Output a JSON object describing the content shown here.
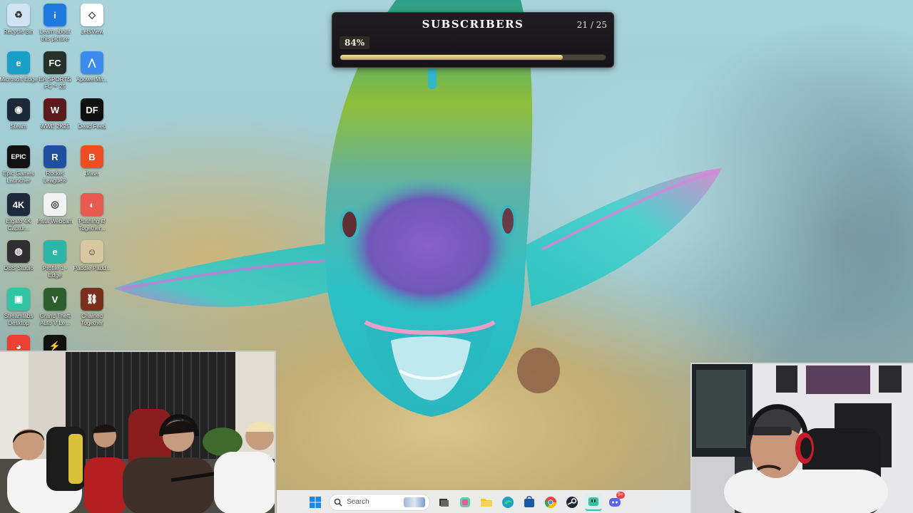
{
  "desktop_icons": [
    {
      "label": "Recycle Bin",
      "icon": "recycle-bin-icon",
      "color": "#cfe3f5",
      "glyph": "♻"
    },
    {
      "label": "Learn about this picture",
      "icon": "info-icon",
      "color": "#1f7ae0",
      "glyph": "i"
    },
    {
      "label": "LetsView",
      "icon": "letsview-icon",
      "color": "#ffffff",
      "glyph": "◇"
    },
    {
      "label": "Microsoft Edge",
      "icon": "edge-icon",
      "color": "#1aa0c8",
      "glyph": "e"
    },
    {
      "label": "EA SPORTS FC™ 25",
      "icon": "ea-sports-fc-icon",
      "color": "#24322a",
      "glyph": "FC"
    },
    {
      "label": "ApowerMir...",
      "icon": "apowermirror-icon",
      "color": "#3c8cf0",
      "glyph": "⋀"
    },
    {
      "label": "Steam",
      "icon": "steam-icon",
      "color": "#1b2838",
      "glyph": "◉"
    },
    {
      "label": "WWE 2K25",
      "icon": "wwe-2k25-icon",
      "color": "#5b1b1b",
      "glyph": "W"
    },
    {
      "label": "Dead Feed",
      "icon": "dead-feed-icon",
      "color": "#101010",
      "glyph": "DF"
    },
    {
      "label": "Epic Games Launcher",
      "icon": "epic-games-icon",
      "color": "#121212",
      "glyph": "EPIC"
    },
    {
      "label": "Rocket League®",
      "icon": "rocket-league-icon",
      "color": "#1f4fa0",
      "glyph": "R"
    },
    {
      "label": "Brave",
      "icon": "brave-icon",
      "color": "#f04b23",
      "glyph": "B"
    },
    {
      "label": "Elgato 4K Captur...",
      "icon": "elgato-4k-icon",
      "color": "#1c2a3c",
      "glyph": "4K"
    },
    {
      "label": "Insta Webcam",
      "icon": "webcam-icon",
      "color": "#f2f2f2",
      "glyph": "◎"
    },
    {
      "label": "Pushing it! Together...",
      "icon": "pushing-it-together-icon",
      "color": "#e85a4f",
      "glyph": "◐"
    },
    {
      "label": "OBS Studio",
      "icon": "obs-studio-icon",
      "color": "#302e31",
      "glyph": "◍"
    },
    {
      "label": "Profile 1 - Edge",
      "icon": "edge-profile-icon",
      "color": "#2bb6a8",
      "glyph": "e"
    },
    {
      "label": "Paddle Padd...",
      "icon": "paddle-paddle-icon",
      "color": "#d8c7a0",
      "glyph": "☺"
    },
    {
      "label": "Streamlabs Desktop",
      "icon": "streamlabs-icon",
      "color": "#31c3a2",
      "glyph": "▣"
    },
    {
      "label": "Grand Theft Auto V Le...",
      "icon": "gta-v-icon",
      "color": "#2d5f2d",
      "glyph": "V"
    },
    {
      "label": "Chained Together",
      "icon": "chained-together-icon",
      "color": "#7a2e1e",
      "glyph": "⛓"
    },
    {
      "label": "",
      "icon": "chrome-icon",
      "color": "#e94235",
      "glyph": "◕"
    },
    {
      "label": "",
      "icon": "green-app-icon",
      "color": "#111111",
      "glyph": "⚡"
    }
  ],
  "goal_widget": {
    "title": "SUBSCRIBERS",
    "count": "21 / 25",
    "percent_label": "84%",
    "progress": 0.84
  },
  "taskbar": {
    "search_placeholder": "Search",
    "apps": [
      "windows-start-icon",
      "search",
      "task-view-icon",
      "copilot-icon",
      "file-explorer-icon",
      "edge-icon",
      "store-icon",
      "chrome-icon",
      "steam-icon",
      "streamlabs-icon",
      "discord-icon"
    ],
    "discord_badge": "9+"
  }
}
